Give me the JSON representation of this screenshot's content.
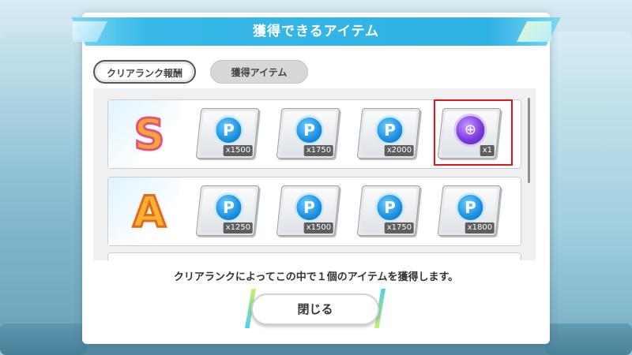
{
  "dialog": {
    "title": "獲得できるアイテム",
    "caption": "クリアランクによってこの中で１個のアイテムを獲得します。",
    "close_label": "閉じる"
  },
  "tabs": [
    {
      "label": "クリアランク報酬",
      "active": true
    },
    {
      "label": "獲得アイテム",
      "active": false
    }
  ],
  "rewards": [
    {
      "rank": "S",
      "items": [
        {
          "icon": "p-coin-icon",
          "glyph": "P",
          "qty": "x1500"
        },
        {
          "icon": "p-coin-icon",
          "glyph": "P",
          "qty": "x1750"
        },
        {
          "icon": "p-coin-icon",
          "glyph": "P",
          "qty": "x2000"
        },
        {
          "icon": "purple-orb-icon",
          "glyph": "⊕",
          "qty": "x1",
          "highlighted": true
        }
      ]
    },
    {
      "rank": "A",
      "items": [
        {
          "icon": "p-coin-icon",
          "glyph": "P",
          "qty": "x1250"
        },
        {
          "icon": "p-coin-icon",
          "glyph": "P",
          "qty": "x1500"
        },
        {
          "icon": "p-coin-icon",
          "glyph": "P",
          "qty": "x1750"
        },
        {
          "icon": "p-coin-icon",
          "glyph": "P",
          "qty": "x1800"
        }
      ]
    }
  ],
  "colors": {
    "banner": "#30b1e4",
    "highlight": "#e2151d",
    "coin": "#1a8fe0",
    "orb": "#7d3de0"
  }
}
